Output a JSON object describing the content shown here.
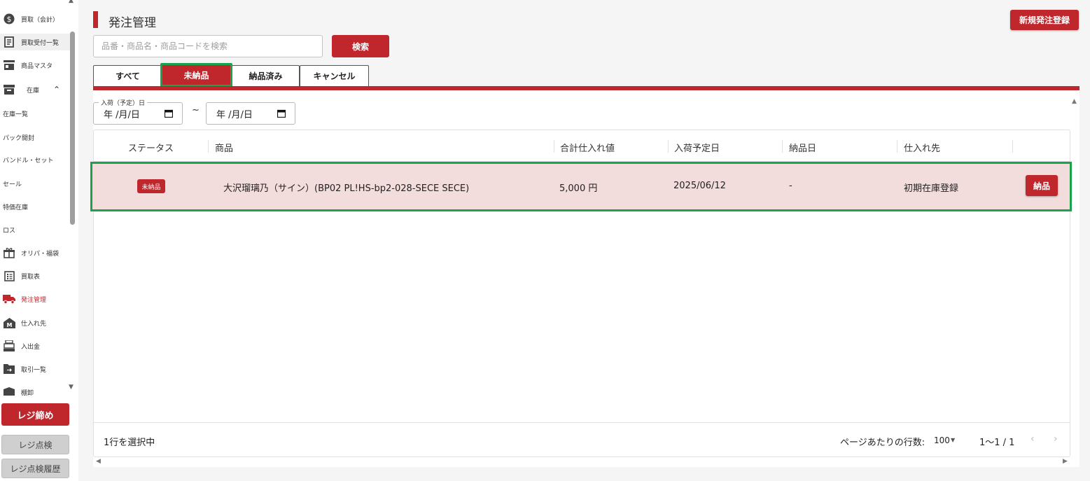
{
  "sidebar": {
    "items": [
      {
        "label": "買取（会計）",
        "icon": "dollar-circle-icon"
      },
      {
        "label": "買取受付一覧",
        "icon": "receipt-icon"
      },
      {
        "label": "商品マスタ",
        "icon": "store-icon"
      },
      {
        "label": "在庫",
        "icon": "archive-box-icon"
      },
      {
        "label": "在庫一覧"
      },
      {
        "label": "パック開封"
      },
      {
        "label": "バンドル・セット"
      },
      {
        "label": "セール"
      },
      {
        "label": "特価在庫"
      },
      {
        "label": "ロス"
      },
      {
        "label": "オリパ・福袋",
        "icon": "gift-box-icon"
      },
      {
        "label": "買取表",
        "icon": "list-sheet-icon"
      },
      {
        "label": "発注管理",
        "icon": "truck-icon"
      },
      {
        "label": "仕入れ先",
        "icon": "warehouse-icon"
      },
      {
        "label": "入出金",
        "icon": "cash-register-icon"
      },
      {
        "label": "取引一覧",
        "icon": "transfer-icon"
      },
      {
        "label": "棚卸",
        "icon": "inventory-icon"
      }
    ],
    "register_close": "レジ締め",
    "register_check": "レジ点検",
    "register_history": "レジ点検履歴"
  },
  "header": {
    "title": "発注管理",
    "new_order_button": "新規発注登録"
  },
  "search": {
    "placeholder": "品番・商品名・商品コードを検索",
    "value": "",
    "button": "検索"
  },
  "tabs": [
    {
      "label": "すべて",
      "active": false
    },
    {
      "label": "未納品",
      "active": true
    },
    {
      "label": "納品済み",
      "active": false
    },
    {
      "label": "キャンセル",
      "active": false
    }
  ],
  "date_filter": {
    "legend": "入荷（予定）日",
    "from_display": "年 /月/日",
    "to_display": "年 /月/日",
    "separator": "~"
  },
  "table": {
    "columns": [
      "ステータス",
      "商品",
      "合計仕入れ値",
      "入荷予定日",
      "納品日",
      "仕入れ先"
    ],
    "rows": [
      {
        "status": "未納品",
        "product": "大沢瑠璃乃（サイン）(BP02 PL!HS-bp2-028-SECE SECE)",
        "total_cost": "5,000 円",
        "arrival_date": "2025/06/12",
        "delivery_date": "-",
        "supplier": "初期在庫登録",
        "action": "納品"
      }
    ]
  },
  "footer": {
    "selected": "1行を選択中",
    "rows_per_page_label": "ページあたりの行数:",
    "rows_per_page": "100",
    "range": "1〜1 / 1"
  },
  "colors": {
    "accent": "#c0272d",
    "highlight_outline": "#1aa34a",
    "selected_row": "#f3dcdc"
  }
}
